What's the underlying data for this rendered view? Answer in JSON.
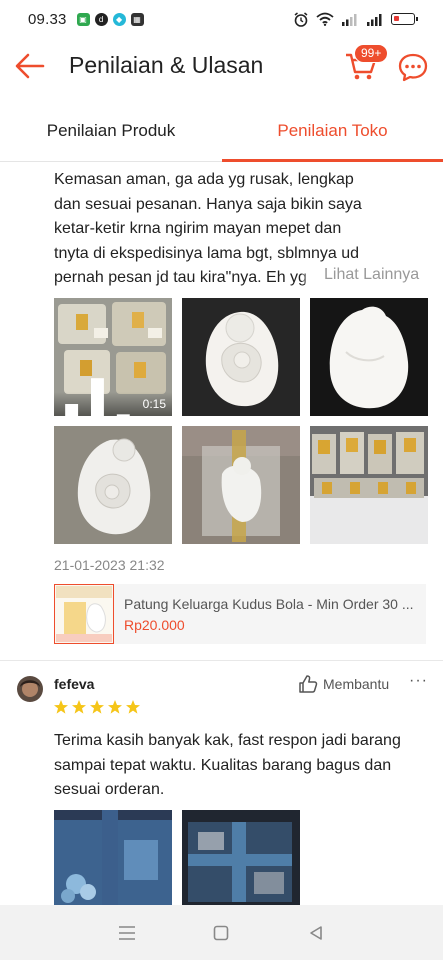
{
  "status_bar": {
    "time": "09.33"
  },
  "header": {
    "title": "Penilaian & Ulasan",
    "cart_badge": "99+"
  },
  "tabs": [
    {
      "label": "Penilaian Produk",
      "active": false
    },
    {
      "label": "Penilaian Toko",
      "active": true
    }
  ],
  "review1": {
    "text_lines": [
      "Kemasan aman, ga ada yg rusak, lengkap",
      "dan sesuai pesanan. Hanya saja bikin saya",
      "ketar-ketir krna ngirim mayan mepet dan",
      "tnyta di ekspedisinya lama bgt, sblmnya ud",
      "pernah pesan jd tau kira\"nya. Eh yg"
    ],
    "see_more": "Lihat Lainnya",
    "video_duration": "0:15",
    "date": "21-01-2023 21:32",
    "product": {
      "name": "Patung Keluarga Kudus Bola - Min Order 30 ...",
      "price": "Rp20.000"
    }
  },
  "review2": {
    "username": "fefeva",
    "helpful_label": "Membantu",
    "more": "···",
    "rating": 5,
    "text_lines": [
      "Terima kasih banyak kak, fast respon jadi barang",
      "sampai tepat waktu. Kualitas barang bagus dan",
      "sesuai orderan."
    ]
  },
  "colors": {
    "accent": "#ee4d2d",
    "star": "#f5c518"
  }
}
